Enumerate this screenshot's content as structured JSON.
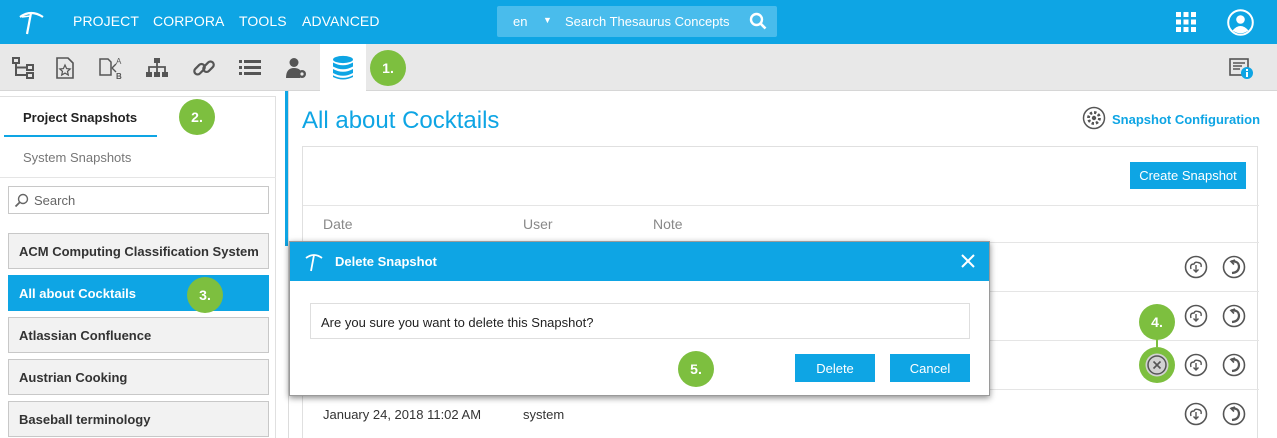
{
  "topbar": {
    "menu": [
      "PROJECT",
      "CORPORA",
      "TOOLS",
      "ADVANCED"
    ],
    "search": {
      "language": "en",
      "placeholder": "Search Thesaurus Concepts"
    }
  },
  "toolbar": {
    "icons": [
      "hierarchy-tree-icon",
      "concept-star-icon",
      "label-ab-icon",
      "sitemap-icon",
      "link-icon",
      "list-icon",
      "user-settings-icon",
      "database-icon"
    ],
    "active_icon": "database-icon",
    "info_icon": "info-panel-icon"
  },
  "callouts": {
    "c1": "1.",
    "c2": "2.",
    "c3": "3.",
    "c4": "4.",
    "c5": "5."
  },
  "left_panel": {
    "tabs": [
      "Project Snapshots",
      "System Snapshots"
    ],
    "search_placeholder": "Search",
    "projects": [
      "ACM Computing Classification System",
      "All about Cocktails",
      "Atlassian Confluence",
      "Austrian Cooking",
      "Baseball terminology"
    ],
    "selected_project": "All about Cocktails"
  },
  "main": {
    "title": "All about Cocktails",
    "config_label": "Snapshot Configuration",
    "create_button": "Create Snapshot",
    "columns": {
      "date": "Date",
      "user": "User",
      "note": "Note"
    },
    "rows": [
      {
        "date": "",
        "user": "",
        "note": ""
      },
      {
        "date": "",
        "user": "",
        "note": ""
      },
      {
        "date": "",
        "user": "",
        "note": ""
      },
      {
        "date": "January 24, 2018 11:02 AM",
        "user": "system",
        "note": ""
      }
    ]
  },
  "modal": {
    "title": "Delete Snapshot",
    "message": "Are you sure you want to delete this Snapshot?",
    "delete_button": "Delete",
    "cancel_button": "Cancel"
  },
  "colors": {
    "brand": "#0ea5e4",
    "callout": "#7dbf3f"
  }
}
